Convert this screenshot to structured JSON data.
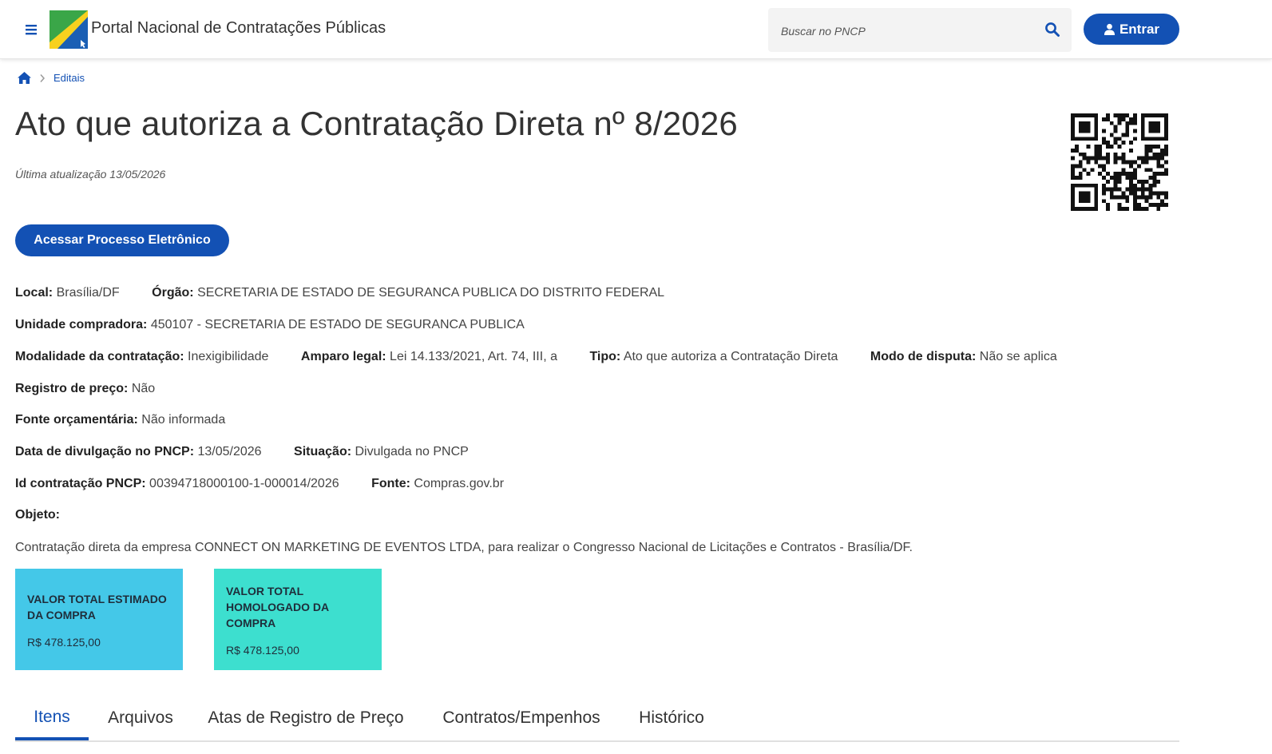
{
  "header": {
    "portal_title": "Portal Nacional de Contratações Públicas",
    "search_placeholder": "Buscar no PNCP",
    "login_label": "Entrar"
  },
  "breadcrumb": {
    "items": [
      "Editais"
    ]
  },
  "page": {
    "title": "Ato que autoriza a Contratação Direta nº 8/2026",
    "last_update": "Última atualização 13/05/2026",
    "process_button": "Acessar Processo Eletrônico"
  },
  "details": {
    "local": {
      "label": "Local:",
      "value": "Brasília/DF"
    },
    "orgao": {
      "label": "Órgão:",
      "value": "SECRETARIA DE ESTADO DE SEGURANCA PUBLICA DO DISTRITO FEDERAL"
    },
    "unidade": {
      "label": "Unidade compradora:",
      "value": "450107 - SECRETARIA DE ESTADO DE SEGURANCA PUBLICA"
    },
    "modalidade": {
      "label": "Modalidade da contratação:",
      "value": "Inexigibilidade"
    },
    "amparo": {
      "label": "Amparo legal:",
      "value": "Lei 14.133/2021, Art. 74, III, a"
    },
    "tipo": {
      "label": "Tipo:",
      "value": "Ato que autoriza a Contratação Direta"
    },
    "modo": {
      "label": "Modo de disputa:",
      "value": "Não se aplica"
    },
    "registro": {
      "label": "Registro de preço:",
      "value": "Não"
    },
    "fonte_orc": {
      "label": "Fonte orçamentária:",
      "value": "Não informada"
    },
    "data_divulgacao": {
      "label": "Data de divulgação no PNCP:",
      "value": "13/05/2026"
    },
    "situacao": {
      "label": "Situação:",
      "value": "Divulgada no PNCP"
    },
    "id_contratacao": {
      "label": "Id contratação PNCP:",
      "value": "00394718000100-1-000014/2026"
    },
    "fonte": {
      "label": "Fonte:",
      "value": "Compras.gov.br"
    },
    "objeto_label": "Objeto:",
    "objeto_text": "Contratação direta da empresa CONNECT ON MARKETING DE EVENTOS LTDA, para realizar o Congresso Nacional de Licitações e Contratos - Brasília/DF."
  },
  "cards": [
    {
      "title": "VALOR TOTAL ESTIMADO DA COMPRA",
      "value": "R$ 478.125,00",
      "color": "#44c8e8"
    },
    {
      "title": "VALOR TOTAL HOMOLOGADO DA COMPRA",
      "value": "R$ 478.125,00",
      "color": "#3ddfcf"
    }
  ],
  "tabs": [
    {
      "label": "Itens",
      "active": true
    },
    {
      "label": "Arquivos",
      "active": false
    },
    {
      "label": "Atas de Registro de Preço",
      "active": false
    },
    {
      "label": "Contratos/Empenhos",
      "active": false
    },
    {
      "label": "Histórico",
      "active": false
    }
  ],
  "colors": {
    "primary": "#1351b4",
    "card_estimated": "#44c8e8",
    "card_homologated": "#3ddfcf"
  },
  "icons": {
    "menu": "menu-icon",
    "logo": "pncp-logo",
    "search": "search-icon",
    "user": "user-icon",
    "home": "home-icon",
    "separator": "chevron-right-icon",
    "qr": "qr-code"
  }
}
